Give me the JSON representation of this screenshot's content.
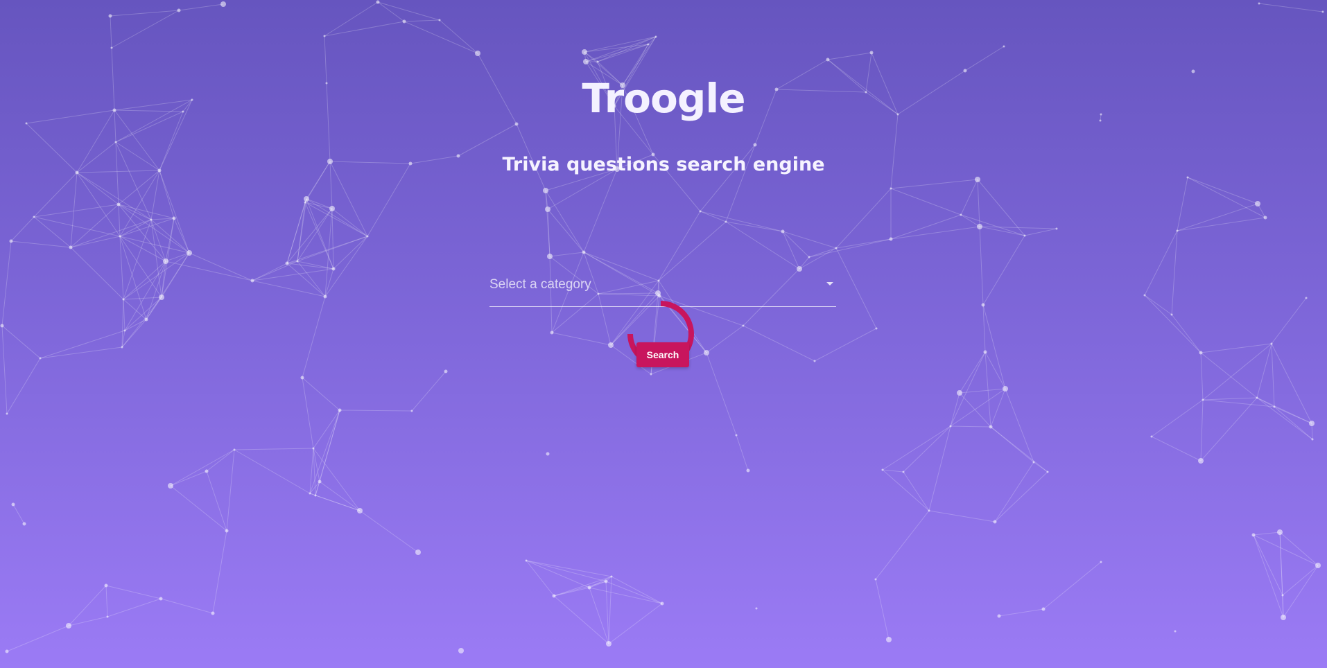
{
  "header": {
    "title": "Troogle",
    "subtitle": "Trivia questions search engine"
  },
  "search_form": {
    "category_placeholder": "Select a category",
    "search_button_label": "Search"
  },
  "colors": {
    "accent": "#c8155d",
    "background_top": "#6655bf",
    "background_bottom": "#9b7bf5"
  },
  "icons": {
    "dropdown": "caret-down-icon",
    "loading": "loading-spinner-icon"
  }
}
